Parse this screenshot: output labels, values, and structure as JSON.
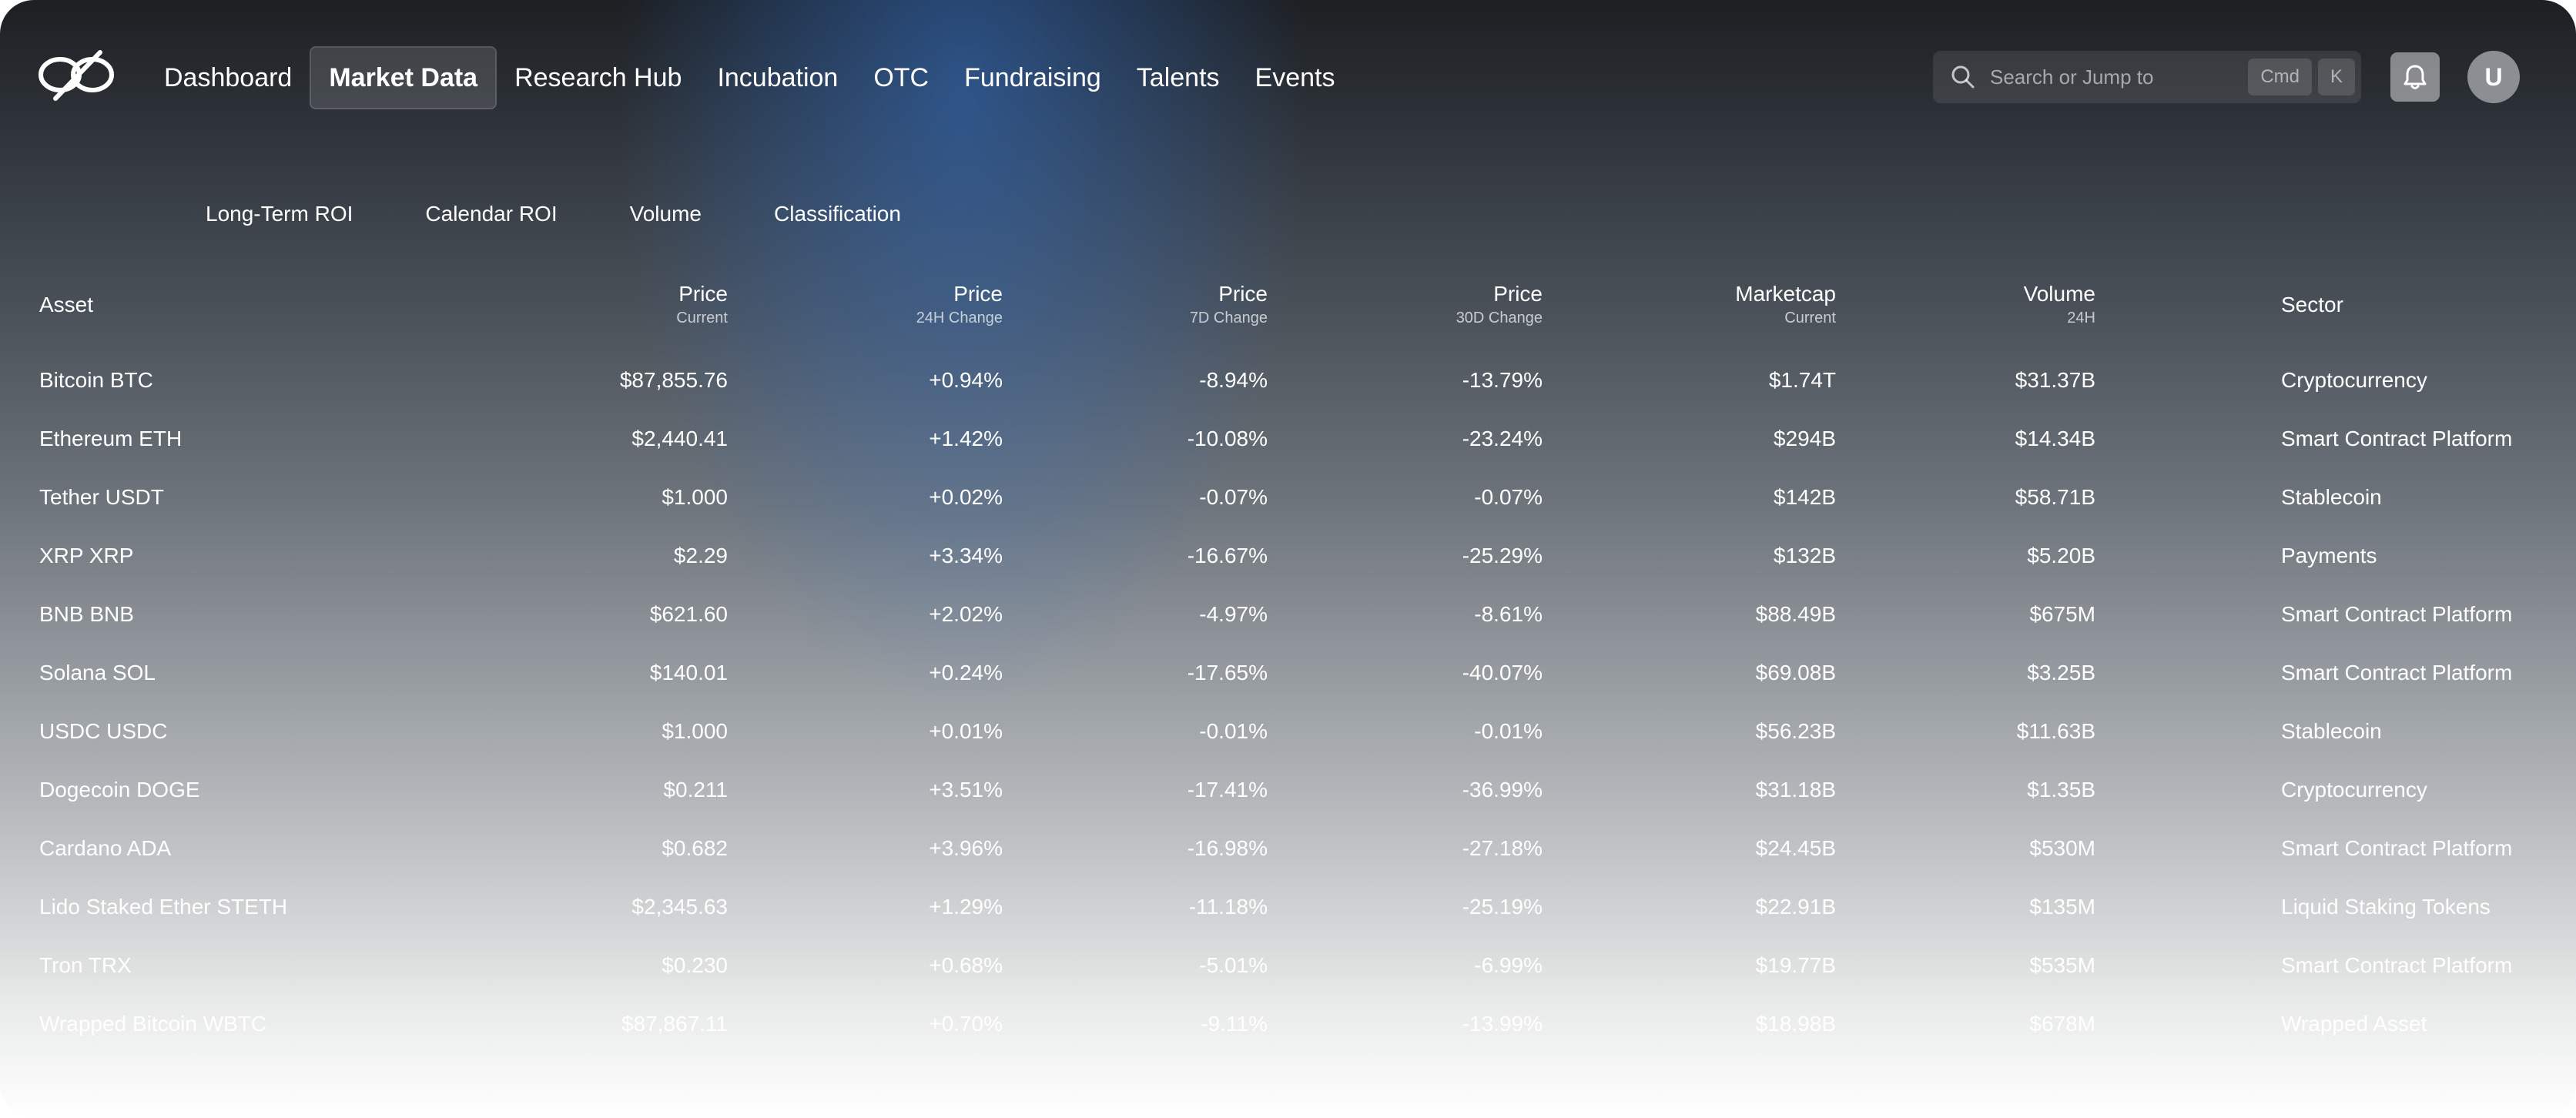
{
  "nav": {
    "items": [
      {
        "label": "Dashboard",
        "active": false
      },
      {
        "label": "Market Data",
        "active": true
      },
      {
        "label": "Research Hub",
        "active": false
      },
      {
        "label": "Incubation",
        "active": false
      },
      {
        "label": "OTC",
        "active": false
      },
      {
        "label": "Fundraising",
        "active": false
      },
      {
        "label": "Talents",
        "active": false
      },
      {
        "label": "Events",
        "active": false
      }
    ]
  },
  "search": {
    "placeholder": "Search or Jump to",
    "kbd1": "Cmd",
    "kbd2": "K"
  },
  "avatar": {
    "initial": "U"
  },
  "subtabs": [
    "Long-Term ROI",
    "Calendar ROI",
    "Volume",
    "Classification"
  ],
  "table": {
    "columns": [
      {
        "title": "Asset",
        "sub": ""
      },
      {
        "title": "Price",
        "sub": "Current"
      },
      {
        "title": "Price",
        "sub": "24H Change"
      },
      {
        "title": "Price",
        "sub": "7D Change"
      },
      {
        "title": "Price",
        "sub": "30D Change"
      },
      {
        "title": "Marketcap",
        "sub": "Current"
      },
      {
        "title": "Volume",
        "sub": "24H"
      },
      {
        "title": "Sector",
        "sub": ""
      }
    ],
    "rows": [
      [
        "Bitcoin BTC",
        "$87,855.76",
        "+0.94%",
        "-8.94%",
        "-13.79%",
        "$1.74T",
        "$31.37B",
        "Cryptocurrency"
      ],
      [
        "Ethereum ETH",
        "$2,440.41",
        "+1.42%",
        "-10.08%",
        "-23.24%",
        "$294B",
        "$14.34B",
        "Smart Contract Platform"
      ],
      [
        "Tether USDT",
        "$1.000",
        "+0.02%",
        "-0.07%",
        "-0.07%",
        "$142B",
        "$58.71B",
        "Stablecoin"
      ],
      [
        "XRP XRP",
        "$2.29",
        "+3.34%",
        "-16.67%",
        "-25.29%",
        "$132B",
        "$5.20B",
        "Payments"
      ],
      [
        "BNB BNB",
        "$621.60",
        "+2.02%",
        "-4.97%",
        "-8.61%",
        "$88.49B",
        "$675M",
        "Smart Contract Platform"
      ],
      [
        "Solana SOL",
        "$140.01",
        "+0.24%",
        "-17.65%",
        "-40.07%",
        "$69.08B",
        "$3.25B",
        "Smart Contract Platform"
      ],
      [
        "USDC USDC",
        "$1.000",
        "+0.01%",
        "-0.01%",
        "-0.01%",
        "$56.23B",
        "$11.63B",
        "Stablecoin"
      ],
      [
        "Dogecoin DOGE",
        "$0.211",
        "+3.51%",
        "-17.41%",
        "-36.99%",
        "$31.18B",
        "$1.35B",
        "Cryptocurrency"
      ],
      [
        "Cardano ADA",
        "$0.682",
        "+3.96%",
        "-16.98%",
        "-27.18%",
        "$24.45B",
        "$530M",
        "Smart Contract Platform"
      ],
      [
        "Lido Staked Ether STETH",
        "$2,345.63",
        "+1.29%",
        "-11.18%",
        "-25.19%",
        "$22.91B",
        "$135M",
        "Liquid Staking Tokens"
      ],
      [
        "Tron TRX",
        "$0.230",
        "+0.68%",
        "-5.01%",
        "-6.99%",
        "$19.77B",
        "$535M",
        "Smart Contract Platform"
      ],
      [
        "Wrapped Bitcoin WBTC",
        "$87,867.11",
        "+0.70%",
        "-9.11%",
        "-13.99%",
        "$18.98B",
        "$678M",
        "Wrapped Asset"
      ]
    ]
  }
}
